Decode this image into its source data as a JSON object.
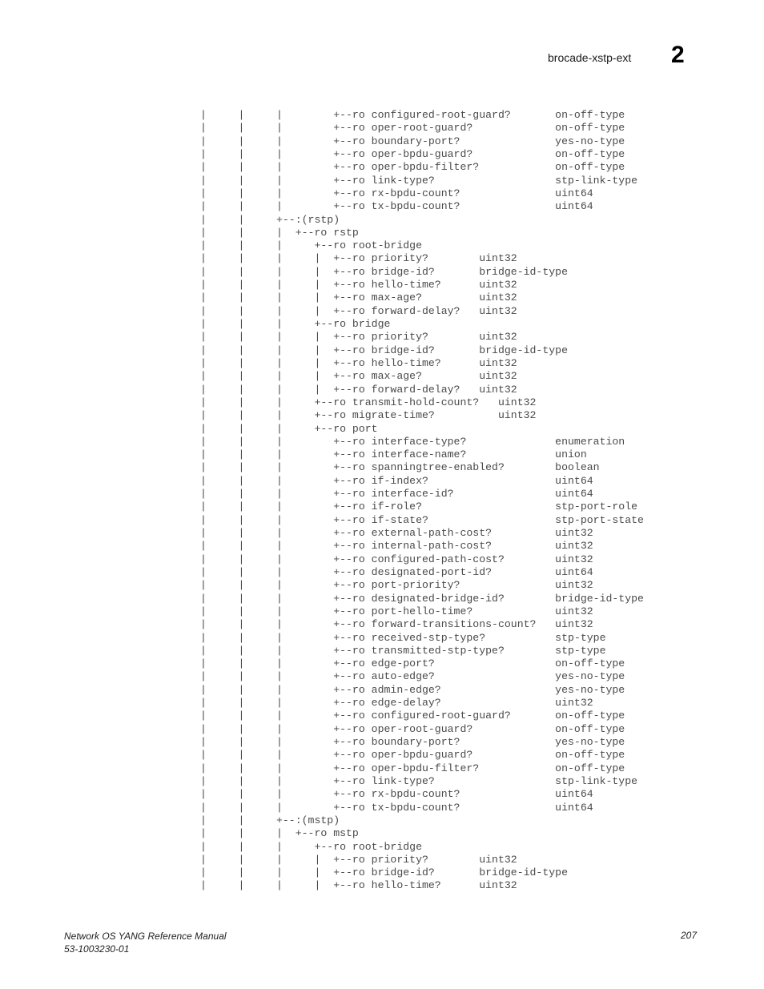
{
  "header": {
    "section_title": "brocade-xstp-ext",
    "chapter_number": "2"
  },
  "tree_lines": [
    "|     |     |        +--ro configured-root-guard?       on-off-type",
    "|     |     |        +--ro oper-root-guard?             on-off-type",
    "|     |     |        +--ro boundary-port?               yes-no-type",
    "|     |     |        +--ro oper-bpdu-guard?             on-off-type",
    "|     |     |        +--ro oper-bpdu-filter?            on-off-type",
    "|     |     |        +--ro link-type?                   stp-link-type",
    "|     |     |        +--ro rx-bpdu-count?               uint64",
    "|     |     |        +--ro tx-bpdu-count?               uint64",
    "|     |     +--:(rstp)",
    "|     |     |  +--ro rstp",
    "|     |     |     +--ro root-bridge",
    "|     |     |     |  +--ro priority?        uint32",
    "|     |     |     |  +--ro bridge-id?       bridge-id-type",
    "|     |     |     |  +--ro hello-time?      uint32",
    "|     |     |     |  +--ro max-age?         uint32",
    "|     |     |     |  +--ro forward-delay?   uint32",
    "|     |     |     +--ro bridge",
    "|     |     |     |  +--ro priority?        uint32",
    "|     |     |     |  +--ro bridge-id?       bridge-id-type",
    "|     |     |     |  +--ro hello-time?      uint32",
    "|     |     |     |  +--ro max-age?         uint32",
    "|     |     |     |  +--ro forward-delay?   uint32",
    "|     |     |     +--ro transmit-hold-count?   uint32",
    "|     |     |     +--ro migrate-time?          uint32",
    "|     |     |     +--ro port",
    "|     |     |        +--ro interface-type?              enumeration",
    "|     |     |        +--ro interface-name?              union",
    "|     |     |        +--ro spanningtree-enabled?        boolean",
    "|     |     |        +--ro if-index?                    uint64",
    "|     |     |        +--ro interface-id?                uint64",
    "|     |     |        +--ro if-role?                     stp-port-role",
    "|     |     |        +--ro if-state?                    stp-port-state",
    "|     |     |        +--ro external-path-cost?          uint32",
    "|     |     |        +--ro internal-path-cost?          uint32",
    "|     |     |        +--ro configured-path-cost?        uint32",
    "|     |     |        +--ro designated-port-id?          uint64",
    "|     |     |        +--ro port-priority?               uint32",
    "|     |     |        +--ro designated-bridge-id?        bridge-id-type",
    "|     |     |        +--ro port-hello-time?             uint32",
    "|     |     |        +--ro forward-transitions-count?   uint32",
    "|     |     |        +--ro received-stp-type?           stp-type",
    "|     |     |        +--ro transmitted-stp-type?        stp-type",
    "|     |     |        +--ro edge-port?                   on-off-type",
    "|     |     |        +--ro auto-edge?                   yes-no-type",
    "|     |     |        +--ro admin-edge?                  yes-no-type",
    "|     |     |        +--ro edge-delay?                  uint32",
    "|     |     |        +--ro configured-root-guard?       on-off-type",
    "|     |     |        +--ro oper-root-guard?             on-off-type",
    "|     |     |        +--ro boundary-port?               yes-no-type",
    "|     |     |        +--ro oper-bpdu-guard?             on-off-type",
    "|     |     |        +--ro oper-bpdu-filter?            on-off-type",
    "|     |     |        +--ro link-type?                   stp-link-type",
    "|     |     |        +--ro rx-bpdu-count?               uint64",
    "|     |     |        +--ro tx-bpdu-count?               uint64",
    "|     |     +--:(mstp)",
    "|     |     |  +--ro mstp",
    "|     |     |     +--ro root-bridge",
    "|     |     |     |  +--ro priority?        uint32",
    "|     |     |     |  +--ro bridge-id?       bridge-id-type",
    "|     |     |     |  +--ro hello-time?      uint32"
  ],
  "footer": {
    "manual_title": "Network OS YANG Reference Manual",
    "doc_number": "53-1003230-01",
    "page_number": "207"
  }
}
